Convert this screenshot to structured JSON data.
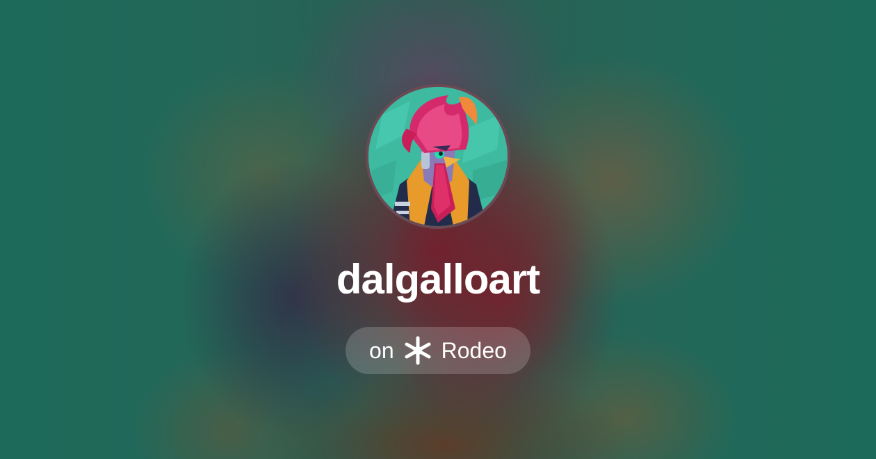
{
  "profile": {
    "username": "dalgalloart",
    "avatar_icon": "rooster-avatar-image"
  },
  "platform": {
    "prefix": "on",
    "name": "Rodeo",
    "logo_icon": "rodeo-logo-icon"
  },
  "colors": {
    "background_primary": "#1f6857",
    "background_center": "#73202d",
    "avatar_bg": "#3dbaa0",
    "comb": "#d42a6b",
    "jacket_orange": "#e89a2a",
    "jacket_navy": "#232b4a",
    "text": "#ffffff"
  }
}
